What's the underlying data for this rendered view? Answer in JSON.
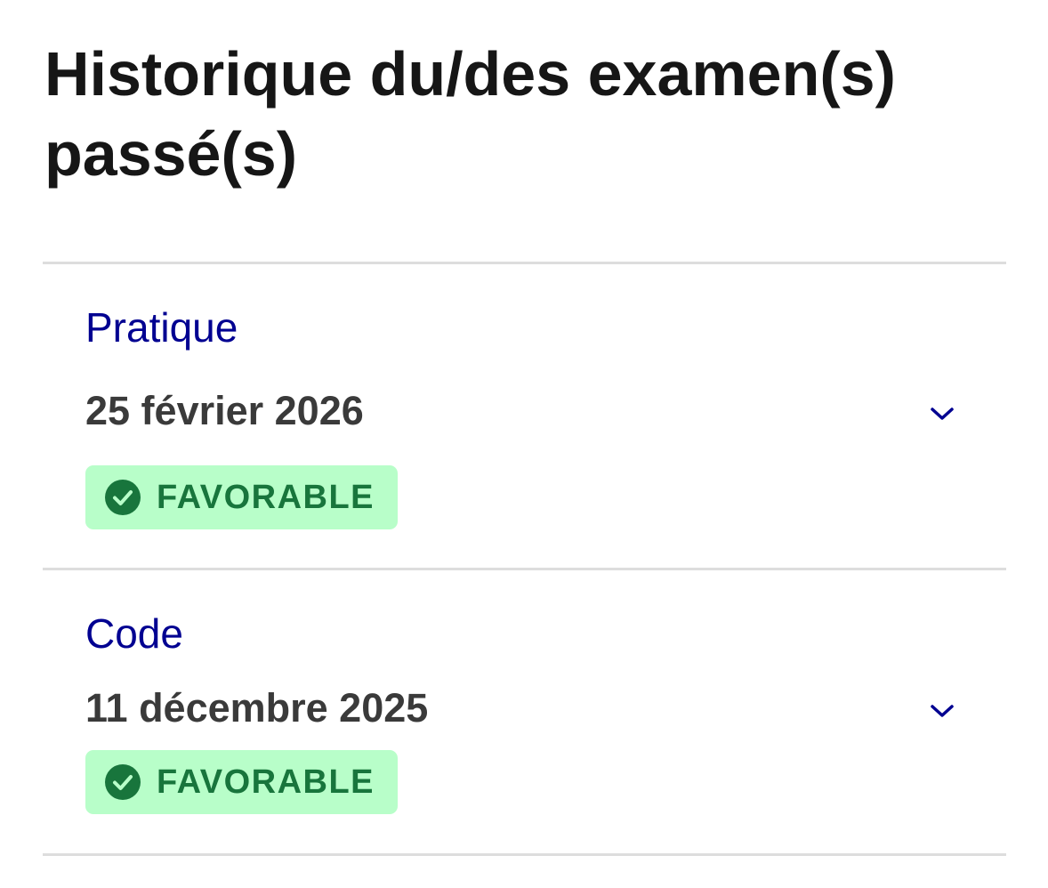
{
  "page": {
    "title": "Historique du/des examen(s) passé(s)"
  },
  "exams": [
    {
      "type": "Pratique",
      "date": "25 février 2026",
      "result": "FAVORABLE",
      "result_icon": "check-circle-icon",
      "expand_icon": "chevron-down-icon"
    },
    {
      "type": "Code",
      "date": "11 décembre 2025",
      "result": "FAVORABLE",
      "result_icon": "check-circle-icon",
      "expand_icon": "chevron-down-icon"
    }
  ],
  "colors": {
    "title": "#161616",
    "exam_type": "#000091",
    "exam_date": "#3a3a3a",
    "badge_background": "#b8fec9",
    "badge_text": "#18753c",
    "divider": "#dddddd"
  }
}
